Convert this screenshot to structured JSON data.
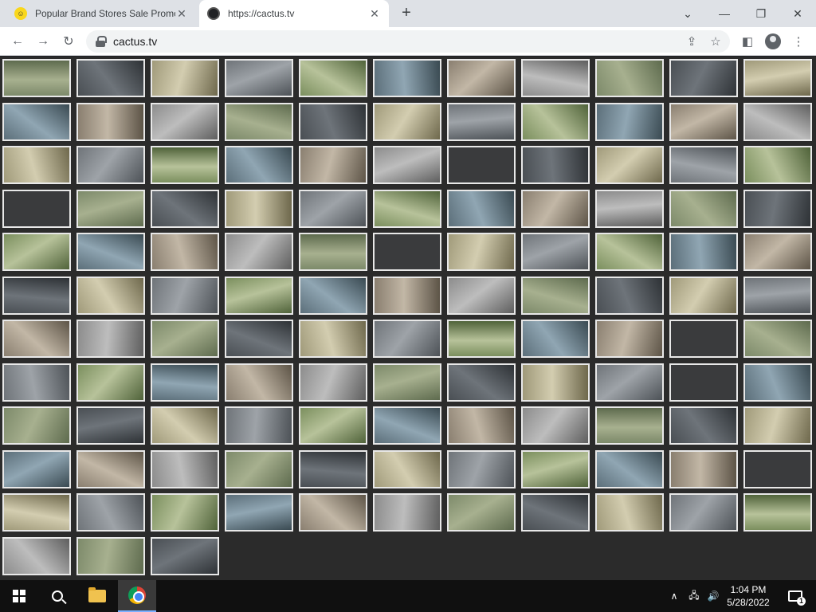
{
  "browser": {
    "tabs": [
      {
        "title": "Popular Brand Stores Sale Promo",
        "favicon": "smiley-icon",
        "active": false
      },
      {
        "title": "https://cactus.tv",
        "favicon": "cactus-icon",
        "active": true
      }
    ],
    "address": "cactus.tv"
  },
  "camera_grid": {
    "rows": 12,
    "columns": 11,
    "tile_count": 124
  },
  "taskbar": {
    "time": "1:04 PM",
    "date": "5/28/2022",
    "notification_count": "1"
  }
}
